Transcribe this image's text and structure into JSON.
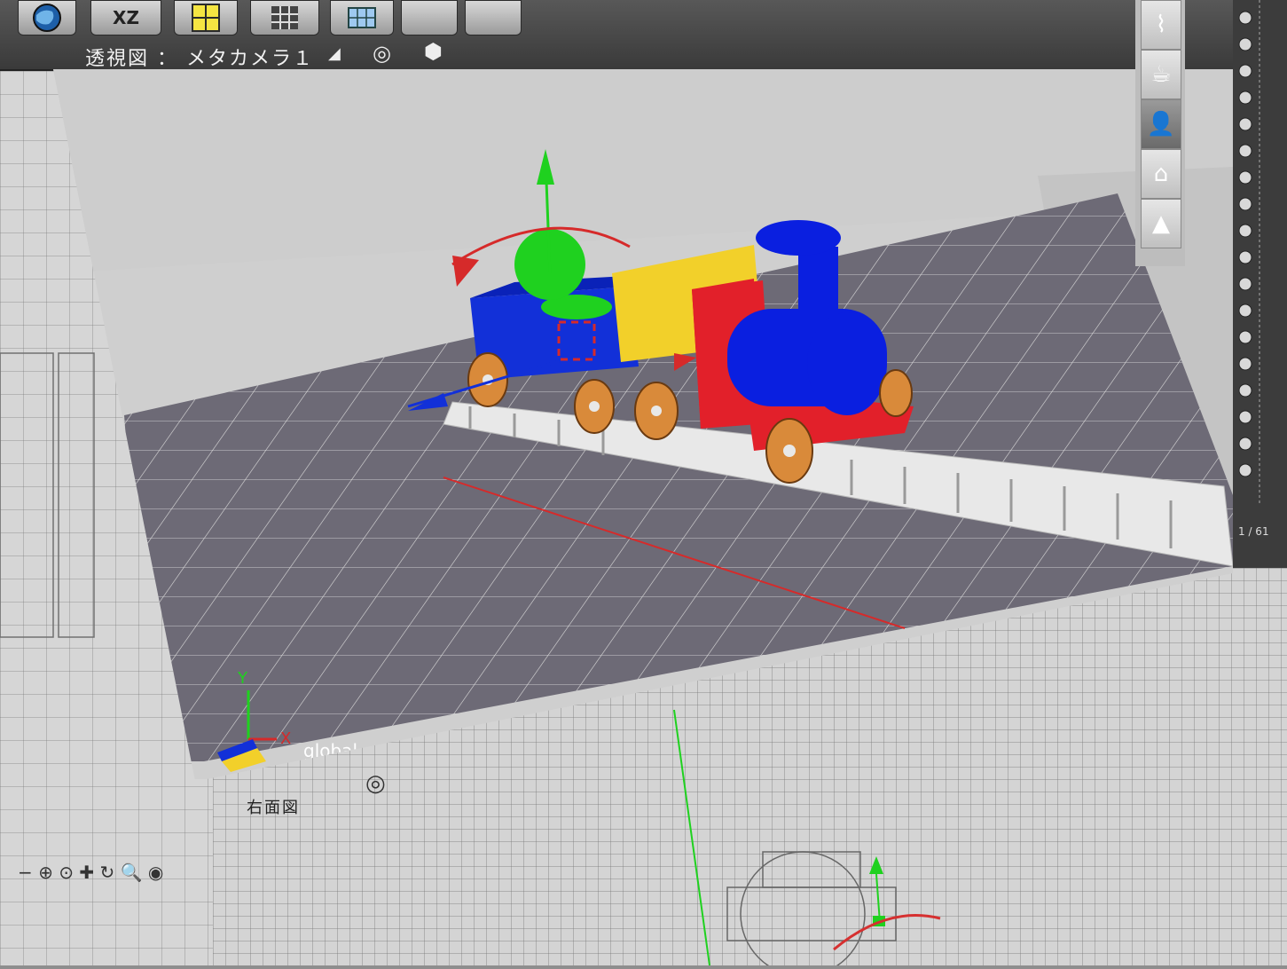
{
  "toolbar": {
    "buttons": [
      {
        "name": "globe-icon"
      },
      {
        "name": "xz-plane-button",
        "label": "XZ"
      },
      {
        "name": "quad-view-icon"
      },
      {
        "name": "grid-icon"
      },
      {
        "name": "grid-blue-icon"
      }
    ]
  },
  "perspective_view": {
    "label": "透視図 ： メタカメラ１",
    "axis_x": "X",
    "axis_y": "Y",
    "coord_mode": "global"
  },
  "side_view": {
    "label": "右面図"
  },
  "side_panel": {
    "page_counter": "1 / 61"
  },
  "colors": {
    "accent_red": "#e02020",
    "accent_green": "#1fd11f",
    "accent_blue": "#1230d8",
    "train_red": "#e2202a",
    "train_blue": "#0a1fe0",
    "train_yellow": "#f2d02a",
    "wheel_orange": "#d98a3a"
  },
  "right_icons": [
    "paperclip-icon",
    "cup-icon",
    "person-icon",
    "house-icon",
    "mountain-icon"
  ]
}
